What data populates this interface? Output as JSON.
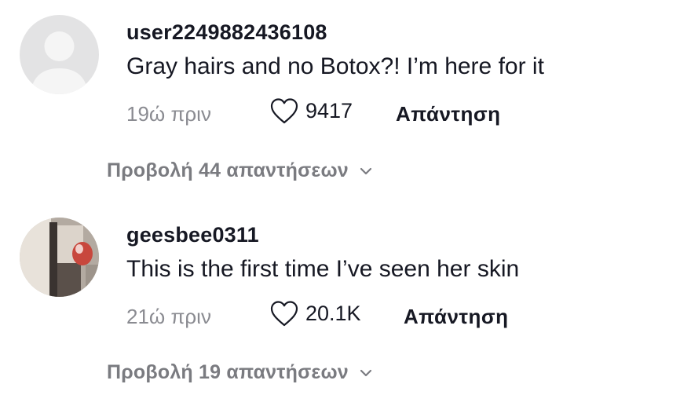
{
  "comments": [
    {
      "username": "user2249882436108",
      "text": "Gray hairs and no Botox?! I’m here for it",
      "time": "19ώ πριν",
      "likes": "9417",
      "reply_label": "Απάντηση",
      "view_replies_label": "Προβολή 44 απαντήσεων",
      "avatar_icon": "default-user-avatar-icon"
    },
    {
      "username": "geesbee0311",
      "text": "This is the first time I’ve seen her skin",
      "time": "21ώ πριν",
      "likes": "20.1K",
      "reply_label": "Απάντηση",
      "view_replies_label": "Προβολή 19 απαντήσεων",
      "avatar_icon": "user-photo-avatar"
    }
  ],
  "colors": {
    "text_primary": "#161823",
    "text_secondary": "#8a8b91",
    "view_replies": "#7a7b80",
    "default_avatar_bg": "#e3e3e4",
    "default_avatar_fg": "#f5f5f5"
  }
}
